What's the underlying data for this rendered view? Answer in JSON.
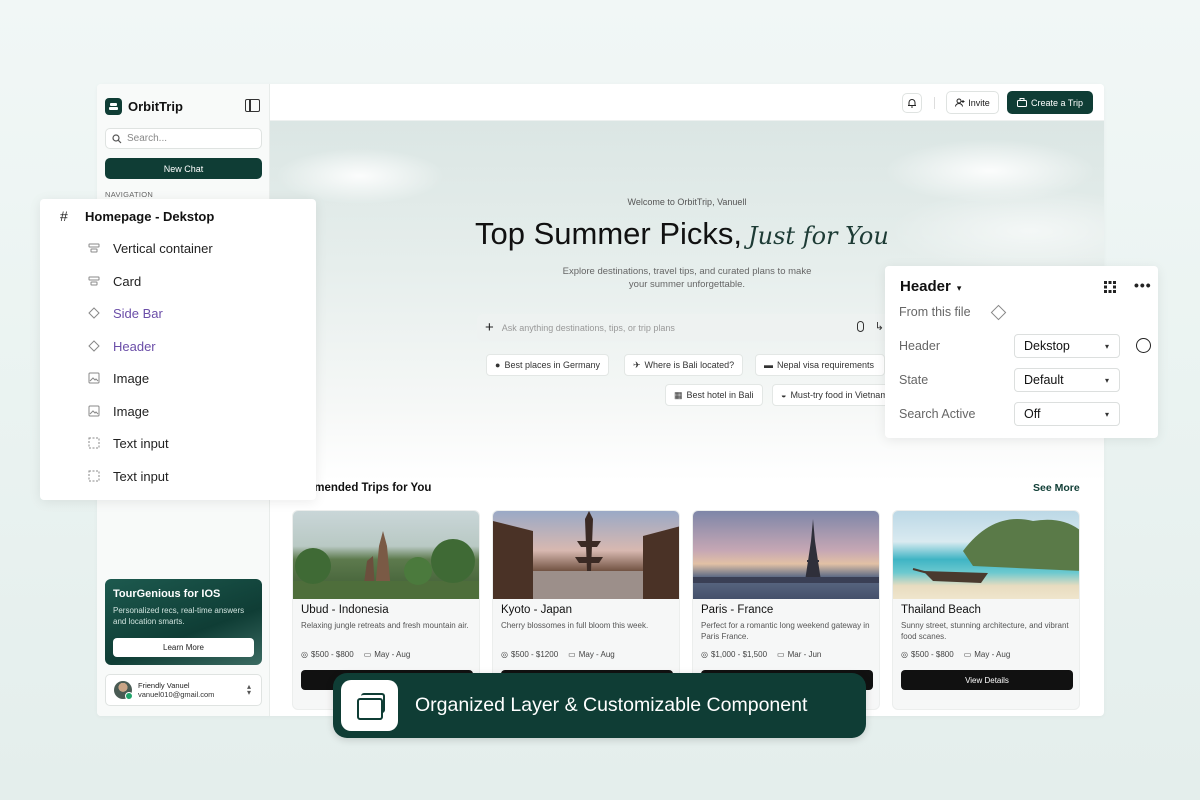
{
  "app": {
    "brand": "OrbitTrip",
    "search_placeholder": "Search...",
    "new_chat": "New Chat",
    "navigation_label": "NAVIGATION",
    "promo": {
      "title": "TourGenious for IOS",
      "description": "Personalized recs, real-time answers and location smarts.",
      "button": "Learn More"
    },
    "user": {
      "name": "Friendly Vanuel",
      "email": "vanuel010@gmail.com"
    }
  },
  "topbar": {
    "invite": "Invite",
    "create_trip": "Create a Trip"
  },
  "hero": {
    "welcome": "Welcome to OrbitTrip, Vanuell",
    "headline": "Top Summer Picks,",
    "headline_script": "Just for You",
    "subtext_line1": "Explore destinations, travel tips, and curated plans to make",
    "subtext_line2": "your summer unforgettable.",
    "ask_placeholder": "Ask anything destinations, tips, or trip plans",
    "chips": [
      "Best places in Germany",
      "Where is Bali located?",
      "Nepal visa requirements",
      "Best hotel in Bali",
      "Must-try food in Vietnam"
    ]
  },
  "trips": {
    "section_title": "ommended Trips for You",
    "see_more": "See More",
    "cards": [
      {
        "title": "Ubud - Indonesia",
        "description": "Relaxing jungle retreats and fresh mountain air.",
        "price": "$500 - $800",
        "dates": "May - Aug",
        "button": ""
      },
      {
        "title": "Kyoto - Japan",
        "description": "Cherry blossomes in full bloom this week.",
        "price": "$500 - $1200",
        "dates": "May - Aug",
        "button": ""
      },
      {
        "title": "Paris - France",
        "description": "Perfect for a romantic long weekend gateway in Paris France.",
        "price": "$1,000 - $1,500",
        "dates": "Mar - Jun",
        "button": ""
      },
      {
        "title": "Thailand Beach",
        "description": "Sunny street, stunning architecture, and vibrant food scanes.",
        "price": "$500 - $800",
        "dates": "May - Aug",
        "button": "View Details"
      }
    ]
  },
  "layers": {
    "root": "Homepage - Dekstop",
    "items": [
      {
        "label": "Vertical container",
        "icon": "frame-icon"
      },
      {
        "label": "Card",
        "icon": "frame-icon"
      },
      {
        "label": "Side Bar",
        "icon": "component-icon"
      },
      {
        "label": "Header",
        "icon": "component-icon"
      },
      {
        "label": "Image",
        "icon": "image-icon"
      },
      {
        "label": "Image",
        "icon": "image-icon"
      },
      {
        "label": "Text input",
        "icon": "dashed-box-icon"
      },
      {
        "label": "Text input",
        "icon": "dashed-box-icon"
      }
    ]
  },
  "props": {
    "title": "Header",
    "from": "From this file",
    "rows": [
      {
        "label": "Header",
        "value": "Dekstop"
      },
      {
        "label": "State",
        "value": "Default"
      },
      {
        "label": "Search Active",
        "value": "Off"
      }
    ]
  },
  "banner": {
    "text": "Organized Layer & Customizable Component"
  },
  "colors": {
    "brand": "#0f3d35",
    "accent_purple": "#6b4ea8"
  }
}
